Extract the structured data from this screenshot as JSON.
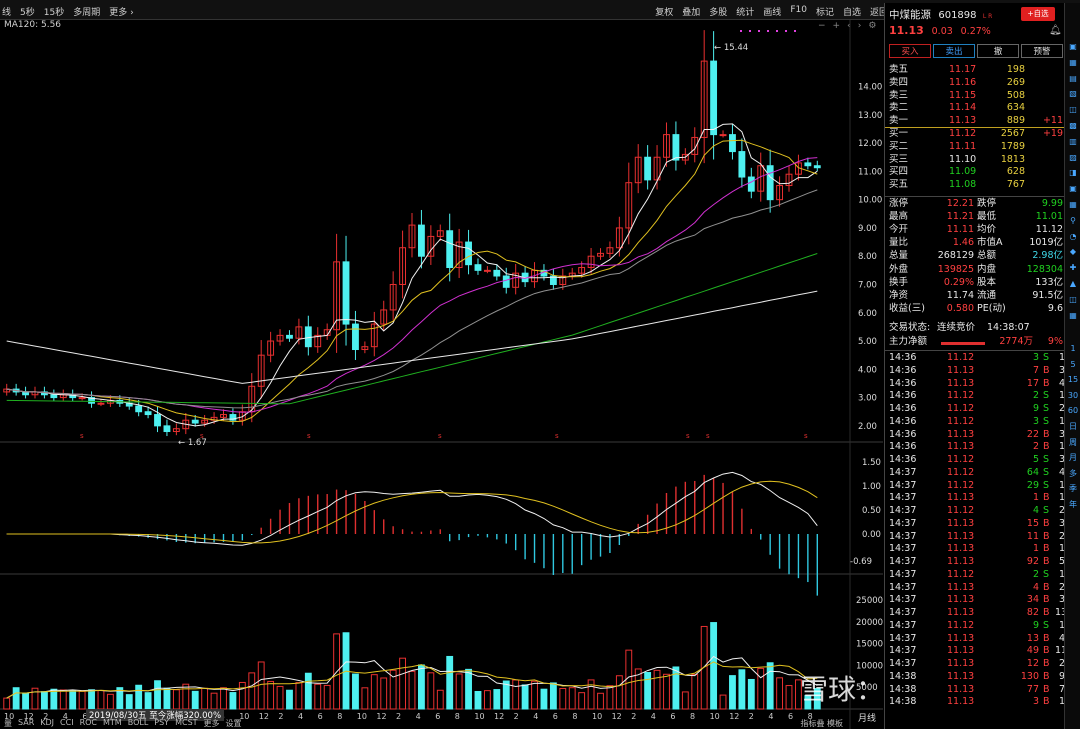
{
  "toolbar": {
    "left": [
      "线",
      "5秒",
      "15秒",
      "多周期",
      "更多 ›"
    ],
    "right": [
      "复权",
      "叠加",
      "多股",
      "统计",
      "画线",
      "F10",
      "标记",
      "自选",
      "返回"
    ]
  },
  "ma_label": "MA120: 5.56",
  "indicator_label": "-0.69",
  "stock": {
    "name": "中煤能源",
    "code": "601898",
    "tag": "L R",
    "add_self": "+自选",
    "price": "11.13",
    "change": "0.03",
    "change_pct": "0.27%"
  },
  "trade_buttons": [
    "买入",
    "卖出",
    "撤",
    "预警"
  ],
  "orderbook": [
    {
      "label": "卖五",
      "price": "11.17",
      "vol": "198",
      "extra": ""
    },
    {
      "label": "卖四",
      "price": "11.16",
      "vol": "269",
      "extra": ""
    },
    {
      "label": "卖三",
      "price": "11.15",
      "vol": "508",
      "extra": ""
    },
    {
      "label": "卖二",
      "price": "11.14",
      "vol": "634",
      "extra": ""
    },
    {
      "label": "卖一",
      "price": "11.13",
      "vol": "889",
      "extra": "+11"
    },
    {
      "label": "买一",
      "price": "11.12",
      "vol": "2567",
      "extra": "+19"
    },
    {
      "label": "买二",
      "price": "11.11",
      "vol": "1789",
      "extra": ""
    },
    {
      "label": "买三",
      "price": "11.10",
      "vol": "1813",
      "extra": ""
    },
    {
      "label": "买四",
      "price": "11.09",
      "vol": "628",
      "extra": ""
    },
    {
      "label": "买五",
      "price": "11.08",
      "vol": "767",
      "extra": ""
    }
  ],
  "stats": [
    {
      "l1": "涨停",
      "v1": "12.21",
      "l2": "跌停",
      "v2": "9.99"
    },
    {
      "l1": "最高",
      "v1": "11.21",
      "l2": "最低",
      "v2": "11.01"
    },
    {
      "l1": "今开",
      "v1": "11.11",
      "l2": "均价",
      "v2": "11.12"
    },
    {
      "l1": "量比",
      "v1": "1.46",
      "l2": "市值A",
      "v2": "1019亿"
    },
    {
      "l1": "总量",
      "v1": "268129",
      "l2": "总额",
      "v2": "2.98亿"
    },
    {
      "l1": "外盘",
      "v1": "139825",
      "l2": "内盘",
      "v2": "128304"
    },
    {
      "l1": "换手",
      "v1": "0.29%",
      "l2": "股本",
      "v2": "133亿"
    },
    {
      "l1": "净资",
      "v1": "11.74",
      "l2": "流通",
      "v2": "91.5亿"
    },
    {
      "l1": "收益(三)",
      "v1": "0.580",
      "l2": "PE(动)",
      "v2": "9.6"
    }
  ],
  "status": {
    "label": "交易状态:",
    "value": "连续竞价",
    "time": "14:38:07"
  },
  "net_flow": {
    "label": "主力净额",
    "value": "2774万",
    "pct": "9%"
  },
  "ticks": [
    {
      "t": "14:36",
      "p": "11.12",
      "v": "3",
      "s": "S",
      "n": "1"
    },
    {
      "t": "14:36",
      "p": "11.13",
      "v": "7",
      "s": "B",
      "n": "3"
    },
    {
      "t": "14:36",
      "p": "11.13",
      "v": "17",
      "s": "B",
      "n": "4"
    },
    {
      "t": "14:36",
      "p": "11.12",
      "v": "2",
      "s": "S",
      "n": "1"
    },
    {
      "t": "14:36",
      "p": "11.12",
      "v": "9",
      "s": "S",
      "n": "2"
    },
    {
      "t": "14:36",
      "p": "11.12",
      "v": "3",
      "s": "S",
      "n": "1"
    },
    {
      "t": "14:36",
      "p": "11.13",
      "v": "22",
      "s": "B",
      "n": "3"
    },
    {
      "t": "14:36",
      "p": "11.13",
      "v": "2",
      "s": "B",
      "n": "1"
    },
    {
      "t": "14:36",
      "p": "11.12",
      "v": "5",
      "s": "S",
      "n": "3"
    },
    {
      "t": "14:37",
      "p": "11.12",
      "v": "64",
      "s": "S",
      "n": "4"
    },
    {
      "t": "14:37",
      "p": "11.12",
      "v": "29",
      "s": "S",
      "n": "1"
    },
    {
      "t": "14:37",
      "p": "11.13",
      "v": "1",
      "s": "B",
      "n": "1"
    },
    {
      "t": "14:37",
      "p": "11.12",
      "v": "4",
      "s": "S",
      "n": "2"
    },
    {
      "t": "14:37",
      "p": "11.13",
      "v": "15",
      "s": "B",
      "n": "3"
    },
    {
      "t": "14:37",
      "p": "11.13",
      "v": "11",
      "s": "B",
      "n": "2"
    },
    {
      "t": "14:37",
      "p": "11.13",
      "v": "1",
      "s": "B",
      "n": "1"
    },
    {
      "t": "14:37",
      "p": "11.13",
      "v": "92",
      "s": "B",
      "n": "5"
    },
    {
      "t": "14:37",
      "p": "11.12",
      "v": "2",
      "s": "S",
      "n": "1"
    },
    {
      "t": "14:37",
      "p": "11.13",
      "v": "4",
      "s": "B",
      "n": "2"
    },
    {
      "t": "14:37",
      "p": "11.13",
      "v": "34",
      "s": "B",
      "n": "3"
    },
    {
      "t": "14:37",
      "p": "11.13",
      "v": "82",
      "s": "B",
      "n": "13"
    },
    {
      "t": "14:37",
      "p": "11.12",
      "v": "9",
      "s": "S",
      "n": "1"
    },
    {
      "t": "14:37",
      "p": "11.13",
      "v": "13",
      "s": "B",
      "n": "4"
    },
    {
      "t": "14:37",
      "p": "11.13",
      "v": "49",
      "s": "B",
      "n": "11"
    },
    {
      "t": "14:37",
      "p": "11.13",
      "v": "12",
      "s": "B",
      "n": "2"
    },
    {
      "t": "14:38",
      "p": "11.13",
      "v": "130",
      "s": "B",
      "n": "9"
    },
    {
      "t": "14:38",
      "p": "11.13",
      "v": "77",
      "s": "B",
      "n": "7"
    },
    {
      "t": "14:38",
      "p": "11.13",
      "v": "3",
      "s": "B",
      "n": "1"
    }
  ],
  "price_axis": [
    "14.00",
    "13.00",
    "12.00",
    "11.00",
    "10.00",
    "9.00",
    "8.00",
    "7.00",
    "6.00",
    "5.00",
    "4.00",
    "3.00",
    "2.00"
  ],
  "macd_axis": [
    "1.50",
    "1.00",
    "0.50",
    "0.00"
  ],
  "vol_axis": [
    "25000",
    "20000",
    "15000",
    "10000",
    "5000"
  ],
  "high_label": "15.44",
  "low_label": "1.67",
  "date_badge": "2019/08/30五",
  "date_suffix": "至今涨幅320.00%",
  "month_label": "月线",
  "bottom_tabs": [
    "量",
    "SAR",
    "KDJ",
    "CCI",
    "ROC",
    "MTM",
    "BOLL",
    "PSY",
    "MCST",
    "更多",
    "设置"
  ],
  "bottom_right": "指标叠 模板",
  "x_ticks": [
    "10",
    "12",
    "2",
    "4",
    "6",
    "8",
    "10",
    "12",
    "2",
    "4",
    "6",
    "8",
    "10",
    "12",
    "2",
    "4",
    "6",
    "8",
    "10",
    "12",
    "2",
    "4",
    "6",
    "8",
    "10",
    "12",
    "2",
    "4",
    "6",
    "8",
    "10",
    "12",
    "2",
    "4",
    "6",
    "8",
    "10",
    "12",
    "2",
    "4",
    "6",
    "8"
  ],
  "watermark": "雪球：滇南王",
  "chart_data": {
    "type": "candlestick",
    "title": "中煤能源 601898 月线",
    "ylim": [
      1.5,
      16
    ],
    "candles_close": [
      3.3,
      3.2,
      3.1,
      3.2,
      3.1,
      3.0,
      3.1,
      3.0,
      3.0,
      2.8,
      2.8,
      2.9,
      2.8,
      2.7,
      2.5,
      2.4,
      2.0,
      1.8,
      1.9,
      2.2,
      2.1,
      2.2,
      2.3,
      2.4,
      2.2,
      2.5,
      3.4,
      4.5,
      5.0,
      5.2,
      5.1,
      5.5,
      4.8,
      5.2,
      5.4,
      7.8,
      5.6,
      4.7,
      4.8,
      5.6,
      6.1,
      7.0,
      8.3,
      9.1,
      8.0,
      8.7,
      8.9,
      7.6,
      8.5,
      7.7,
      7.5,
      7.5,
      7.3,
      6.9,
      7.4,
      7.1,
      7.5,
      7.3,
      7.0,
      7.3,
      7.4,
      7.6,
      8.0,
      8.1,
      8.3,
      9.0,
      10.6,
      11.5,
      10.7,
      11.5,
      12.3,
      11.4,
      11.6,
      12.2,
      14.9,
      12.3,
      12.3,
      11.7,
      10.8,
      10.3,
      11.2,
      10.0,
      10.5,
      10.9,
      11.3,
      11.2,
      11.13
    ]
  }
}
